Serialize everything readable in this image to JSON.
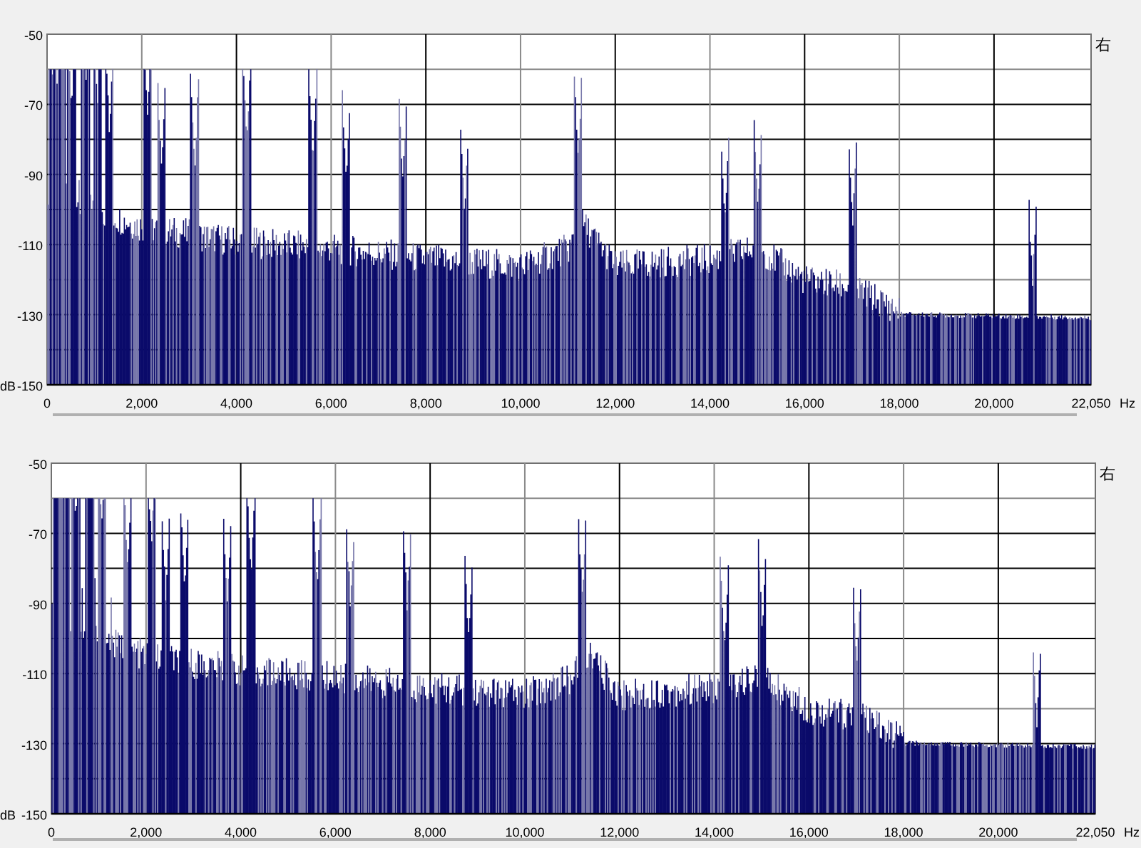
{
  "panels": [
    {
      "channel_label": "右",
      "y_unit": "dB",
      "x_unit": "Hz",
      "y_ticks": [
        "-50",
        "-70",
        "-90",
        "-110",
        "-130",
        "-150"
      ],
      "x_ticks": [
        "0",
        "2,000",
        "4,000",
        "6,000",
        "8,000",
        "10,000",
        "12,000",
        "14,000",
        "16,000",
        "18,000",
        "20,000",
        "22,050"
      ]
    },
    {
      "channel_label": "右",
      "y_unit": "dB",
      "x_unit": "Hz",
      "y_ticks": [
        "-50",
        "-70",
        "-90",
        "-110",
        "-130",
        "-150"
      ],
      "x_ticks": [
        "0",
        "2,000",
        "4,000",
        "6,000",
        "8,000",
        "10,000",
        "12,000",
        "14,000",
        "16,000",
        "18,000",
        "20,000",
        "22,050"
      ]
    }
  ]
}
